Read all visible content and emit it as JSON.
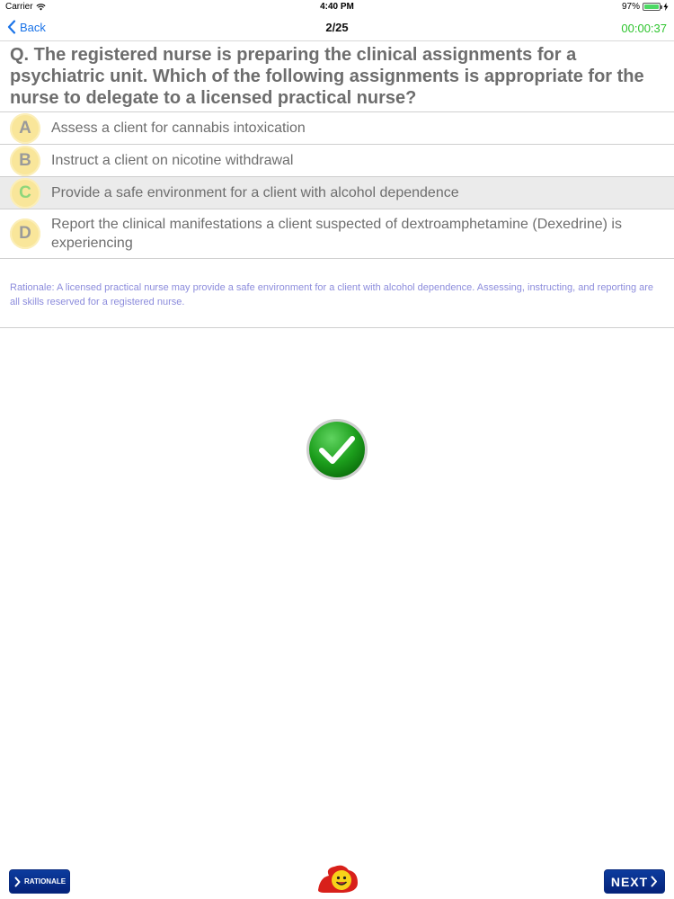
{
  "status_bar": {
    "carrier": "Carrier",
    "time": "4:40 PM",
    "battery": "97%",
    "battery_level": 0.97,
    "wifi_icon": "wifi-icon",
    "battery_icon": "battery-icon",
    "charging_icon": "charging-icon"
  },
  "nav": {
    "back_label": "Back",
    "progress": "2/25",
    "timer": "00:00:37",
    "timer_color": "#2ec42e",
    "back_color": "#1a73e8"
  },
  "question": {
    "text": "Q. The registered nurse is preparing the clinical assignments for a psychiatric unit. Which of the following assignments is appropriate for the nurse to delegate to a licensed practical nurse?"
  },
  "options": [
    {
      "letter": "A",
      "text": "Assess a client for cannabis intoxication",
      "selected": false
    },
    {
      "letter": "B",
      "text": "Instruct a client on nicotine withdrawal",
      "selected": false
    },
    {
      "letter": "C",
      "text": "Provide a safe environment for a client with alcohol dependence",
      "selected": true
    },
    {
      "letter": "D",
      "text": "Report the clinical manifestations a client suspected of dextroamphetamine (Dexedrine) is experiencing",
      "selected": false
    }
  ],
  "rationale": {
    "text": "Rationale: A licensed practical nurse may provide a safe environment for a client with alcohol dependence. Assessing, instructing, and reporting are all skills reserved for a registered nurse.",
    "color": "#8c8cdc"
  },
  "result": {
    "icon": "checkmark-icon",
    "color": "#1a9a1a"
  },
  "toolbar": {
    "rationale_label": "RATIONALE",
    "next_label": "NEXT",
    "mascot_icon": "smiley-mascot-icon",
    "button_color": "#05237a"
  }
}
